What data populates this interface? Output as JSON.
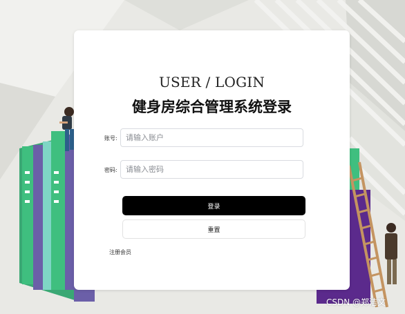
{
  "login": {
    "title_en": "USER / LOGIN",
    "title_cn": "健身房综合管理系统登录",
    "account_label": "账号:",
    "account_placeholder": "请输入账户",
    "password_label": "密码:",
    "password_placeholder": "请输入密码",
    "login_button": "登录",
    "reset_button": "重置",
    "register_link": "注册会员"
  },
  "watermark": "CSDN @郑洁文",
  "colors": {
    "background": "#e9e9e5",
    "card": "#ffffff",
    "primary_button": "#000000",
    "book_green": "#3fbf7f",
    "book_purple": "#6b5fa8",
    "ladder": "#c49461"
  }
}
